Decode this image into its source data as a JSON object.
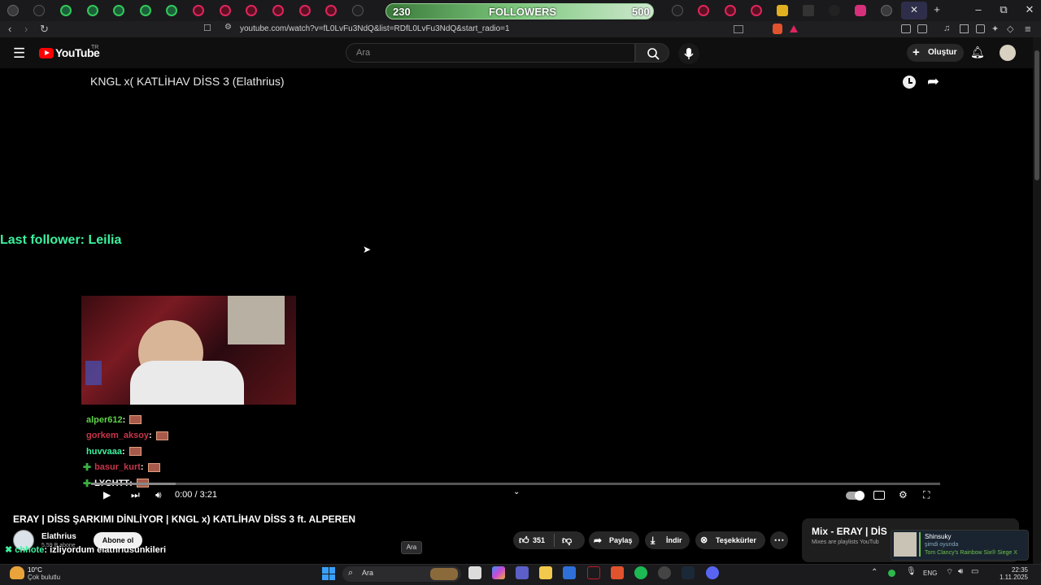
{
  "browser": {
    "url": "youtube.com/watch?v=fL0LvFu3NdQ&list=RDfL0LvFu3NdQ&start_radio=1",
    "follower_goal": {
      "current": "230",
      "label": "FOLLOWERS",
      "target": "500",
      "progress_fraction": 0.46
    },
    "window_controls": {
      "minimize": "–",
      "maximize": "⧉",
      "close": "✕"
    },
    "new_tab": "+"
  },
  "youtube": {
    "logo_text": "YouTube",
    "region": "TR",
    "search_placeholder": "Ara",
    "create_label": "Oluştur"
  },
  "video": {
    "overlay_title": "KNGL x( KATLİHAV DİSS 3 (Elathrius)",
    "last_follower": "Last follower: Leilia",
    "chat": [
      {
        "user": "alper612",
        "color": "#5fd24a",
        "sep": " :",
        "plus": false
      },
      {
        "user": "gorkem_aksoy",
        "color": "#c7354a",
        "sep": " :",
        "plus": false
      },
      {
        "user": "huvvaaa",
        "color": "#3cf29e",
        "sep": " :",
        "plus": false
      },
      {
        "user": "basur_kurt",
        "color": "#c7354a",
        "sep": " :",
        "plus": true
      },
      {
        "user": "LYGHTT",
        "color": "#ffffff",
        "sep": " :",
        "plus": true
      }
    ],
    "time": "0:00 / 3:21",
    "progress_fraction": 0.0
  },
  "watch": {
    "title": "ERAY | DİSS ŞARKIMI DİNLİYOR | KNGL x) KATLİHAV DİSS 3 ft. ALPEREN",
    "channel": "Elathrius",
    "subscribers": "5,59 B abone",
    "subscribe_label": "Abone ol",
    "likes": "351",
    "share_label": "Paylaş",
    "download_label": "İndir",
    "thanks_label": "Teşekkürler",
    "more_label": "⋯"
  },
  "stream_overlay": {
    "user": "chhote",
    "message": ": izliyordum elathriusunkileri"
  },
  "sidebar": {
    "mix_title": "Mix - ERAY | DİS",
    "mix_sub": "Mixes are playlists YouTub"
  },
  "steam_popup": {
    "name": "Shinsuky",
    "status": "şimdi oyunda",
    "game": "Tom Clancy's Rainbow Six® Siege X"
  },
  "taskbar": {
    "temperature": "10°C",
    "weather": "Çok bulutlu",
    "search_text": "Ara",
    "tooltip": "Ara",
    "language": "ENG",
    "time": "22:35",
    "date": "1.11.2025"
  }
}
